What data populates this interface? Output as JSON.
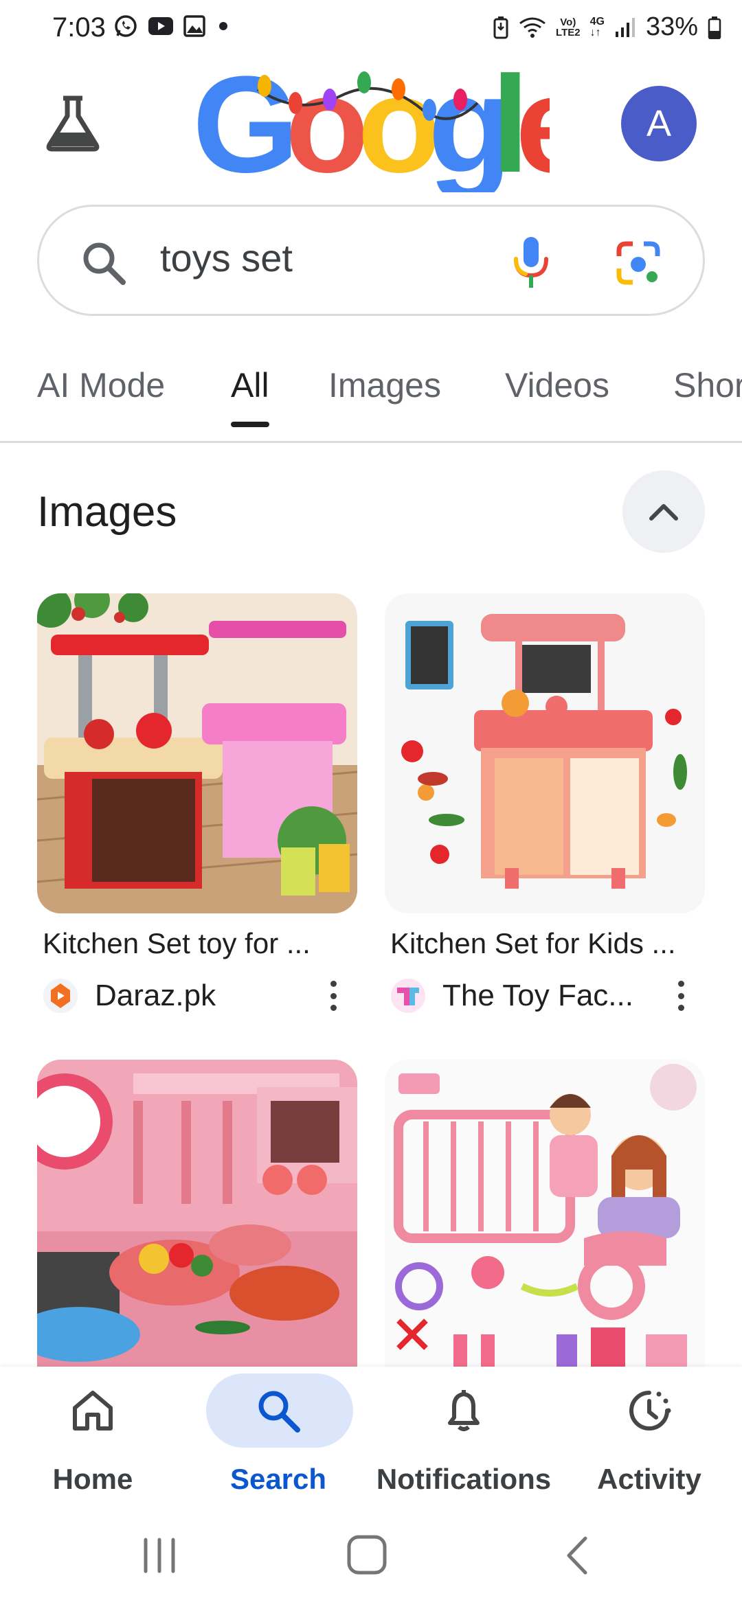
{
  "status_bar": {
    "time": "7:03",
    "network_top": "Vo)",
    "network_bottom": "LTE2",
    "network_gen": "4G",
    "battery": "33%"
  },
  "header": {
    "logo_text": "Google",
    "avatar_letter": "A"
  },
  "search": {
    "query": "toys set"
  },
  "tabs": [
    {
      "label": "AI Mode"
    },
    {
      "label": "All"
    },
    {
      "label": "Images"
    },
    {
      "label": "Videos"
    },
    {
      "label": "Shor"
    }
  ],
  "images_section": {
    "title": "Images",
    "results": [
      {
        "caption": "Kitchen Set toy for ...",
        "source": "Daraz.pk"
      },
      {
        "caption": "Kitchen Set for Kids ...",
        "source": "The Toy Fac..."
      }
    ]
  },
  "bottom_nav": [
    {
      "label": "Home"
    },
    {
      "label": "Search"
    },
    {
      "label": "Notifications"
    },
    {
      "label": "Activity"
    }
  ],
  "colors": {
    "accent": "#0b57d0",
    "avatar": "#4a5cc7",
    "active_pill": "#dce6fb"
  }
}
